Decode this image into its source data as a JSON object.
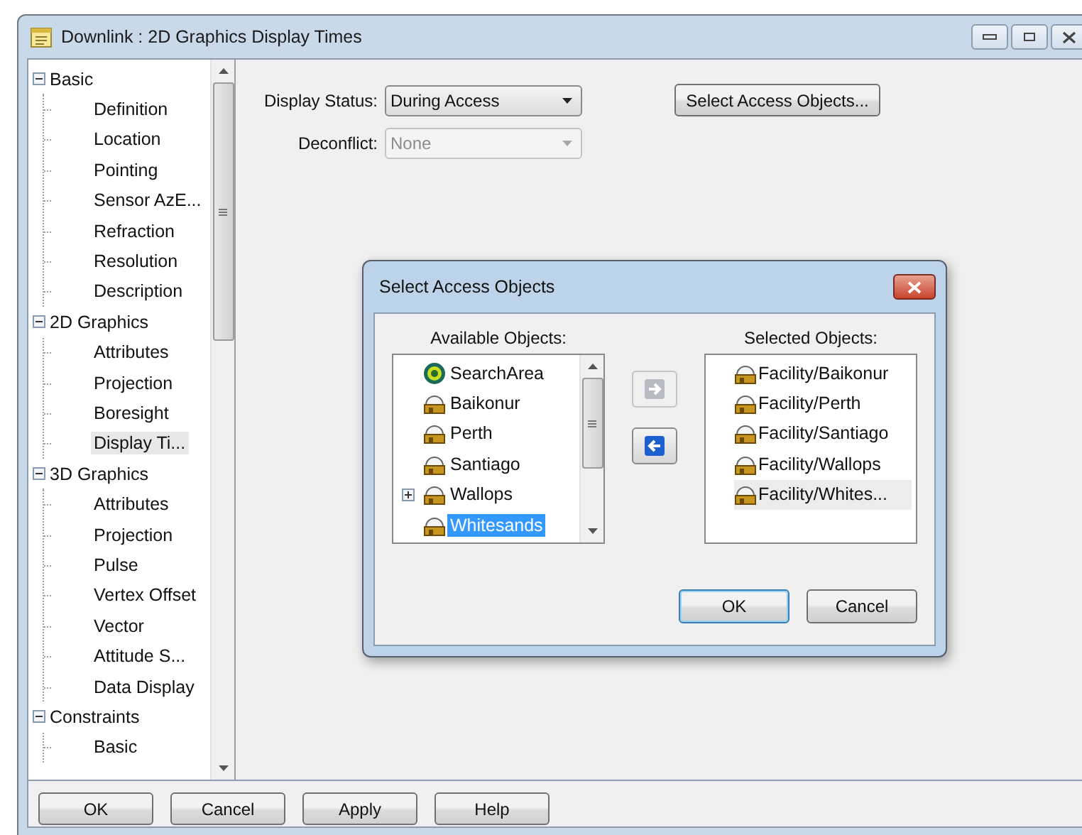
{
  "window": {
    "title": "Downlink : 2D Graphics Display Times"
  },
  "tree": [
    {
      "label": "Basic",
      "expanded": true,
      "children": [
        {
          "label": "Definition",
          "selected": false
        },
        {
          "label": "Location",
          "selected": false
        },
        {
          "label": "Pointing",
          "selected": false
        },
        {
          "label": "Sensor AzE...",
          "selected": false
        },
        {
          "label": "Refraction",
          "selected": false
        },
        {
          "label": "Resolution",
          "selected": false
        },
        {
          "label": "Description",
          "selected": false
        }
      ]
    },
    {
      "label": "2D Graphics",
      "expanded": true,
      "children": [
        {
          "label": "Attributes",
          "selected": false
        },
        {
          "label": "Projection",
          "selected": false
        },
        {
          "label": "Boresight",
          "selected": false
        },
        {
          "label": "Display Ti...",
          "selected": true
        }
      ]
    },
    {
      "label": "3D Graphics",
      "expanded": true,
      "children": [
        {
          "label": "Attributes",
          "selected": false
        },
        {
          "label": "Projection",
          "selected": false
        },
        {
          "label": "Pulse",
          "selected": false
        },
        {
          "label": "Vertex Offset",
          "selected": false
        },
        {
          "label": "Vector",
          "selected": false
        },
        {
          "label": "Attitude S...",
          "selected": false
        },
        {
          "label": "Data Display",
          "selected": false
        }
      ]
    },
    {
      "label": "Constraints",
      "expanded": true,
      "children": [
        {
          "label": "Basic",
          "selected": false
        }
      ]
    }
  ],
  "form": {
    "display_status": {
      "label": "Display Status:",
      "value": "During Access",
      "disabled": false
    },
    "deconflict": {
      "label": "Deconflict:",
      "value": "None",
      "disabled": true
    },
    "select_button": "Select Access Objects..."
  },
  "dialog": {
    "title": "Select Access Objects",
    "available_label": "Available Objects:",
    "selected_label": "Selected Objects:",
    "available": [
      {
        "label": "SearchArea",
        "kind": "area",
        "expandable": false,
        "selected": false
      },
      {
        "label": "Baikonur",
        "kind": "facility",
        "expandable": false,
        "selected": false
      },
      {
        "label": "Perth",
        "kind": "facility",
        "expandable": false,
        "selected": false
      },
      {
        "label": "Santiago",
        "kind": "facility",
        "expandable": false,
        "selected": false
      },
      {
        "label": "Wallops",
        "kind": "facility",
        "expandable": true,
        "selected": false
      },
      {
        "label": "Whitesands",
        "kind": "facility",
        "expandable": false,
        "selected": true
      }
    ],
    "add_disabled": true,
    "remove_disabled": false,
    "chosen": [
      {
        "label": "Facility/Baikonur",
        "selected": false
      },
      {
        "label": "Facility/Perth",
        "selected": false
      },
      {
        "label": "Facility/Santiago",
        "selected": false
      },
      {
        "label": "Facility/Wallops",
        "selected": false
      },
      {
        "label": "Facility/Whites...",
        "selected": true
      }
    ],
    "buttons": [
      "OK",
      "Cancel"
    ]
  },
  "buttons": [
    "OK",
    "Cancel",
    "Apply",
    "Help"
  ]
}
